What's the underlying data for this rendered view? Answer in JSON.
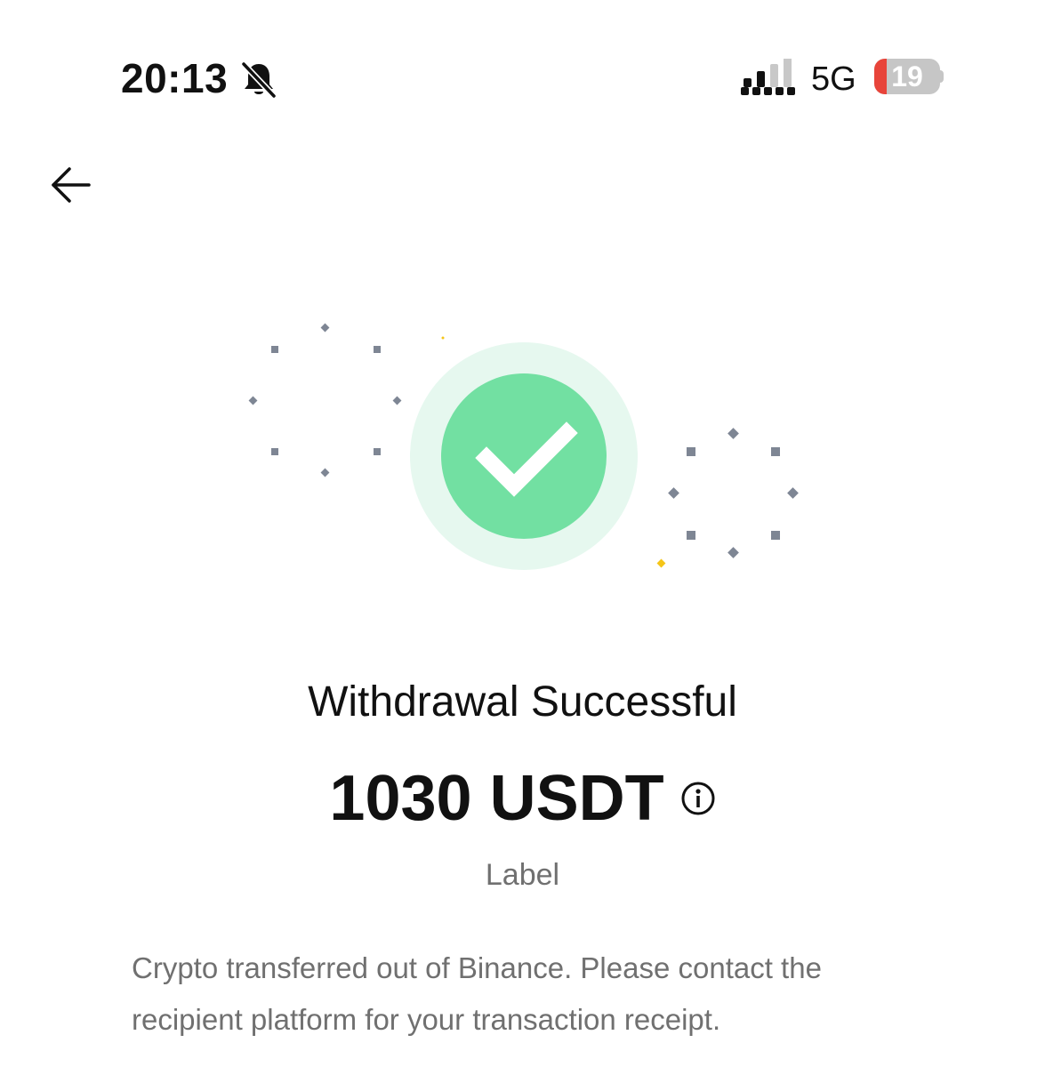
{
  "status_bar": {
    "time": "20:13",
    "network": "5G",
    "battery_level": "19",
    "battery_fraction": 0.19,
    "signal_bars_filled": 2,
    "signal_bars_total": 4,
    "icons": [
      "bell-slash-icon",
      "signal-icon",
      "battery-icon"
    ]
  },
  "nav": {
    "back_icon": "arrow-left-icon"
  },
  "success": {
    "icon": "checkmark-icon",
    "title": "Withdrawal Successful",
    "amount": "1030 USDT",
    "info_icon": "info-icon",
    "label": "Label",
    "description": "Crypto transferred out of Binance. Please contact the recipient platform for your transaction receipt."
  },
  "colors": {
    "success_green": "#72e0a2",
    "success_halo": "#e6f8ef",
    "confetti_gray": "#7e8694",
    "confetti_yellow": "#f5c518",
    "battery_low": "#e8443a",
    "muted_text": "#707070"
  }
}
